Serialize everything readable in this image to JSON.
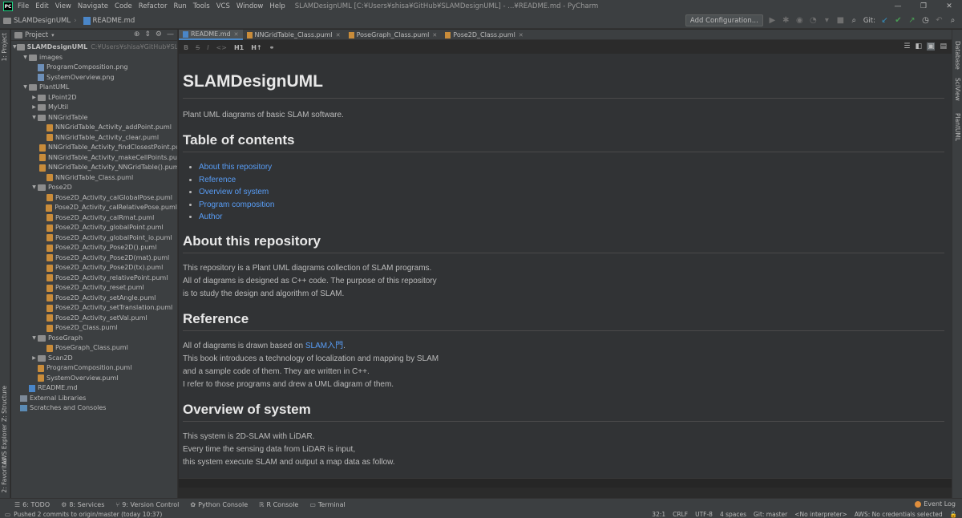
{
  "window": {
    "title": "SLAMDesignUML [C:¥Users¥shisa¥GitHub¥SLAMDesignUML] - ...¥README.md - PyCharm"
  },
  "menu": [
    "File",
    "Edit",
    "View",
    "Navigate",
    "Code",
    "Refactor",
    "Run",
    "Tools",
    "VCS",
    "Window",
    "Help"
  ],
  "navbar": {
    "project": "SLAMDesignUML",
    "file": "README.md",
    "add_configuration": "Add Configuration...",
    "git_label": "Git:"
  },
  "left_stripe": {
    "project": "1: Project",
    "structure": "Z: Structure",
    "aws": "AWS Explorer",
    "favorites": "2: Favorites"
  },
  "right_stripe": {
    "database": "Database",
    "sciview": "SciView",
    "plantuml": "PlantUML"
  },
  "project_panel": {
    "title": "Project",
    "root": "SLAMDesignUML",
    "root_path": "C:¥Users¥shisa¥GitHub¥SLAMDesignUML",
    "tree": [
      {
        "label": "images",
        "type": "folder",
        "depth": 1,
        "open": true
      },
      {
        "label": "ProgramComposition.png",
        "type": "png",
        "depth": 2
      },
      {
        "label": "SystemOverview.png",
        "type": "png",
        "depth": 2
      },
      {
        "label": "PlantUML",
        "type": "folder",
        "depth": 1,
        "open": true
      },
      {
        "label": "LPoint2D",
        "type": "folder",
        "depth": 2,
        "open": false
      },
      {
        "label": "MyUtil",
        "type": "folder",
        "depth": 2,
        "open": false
      },
      {
        "label": "NNGridTable",
        "type": "folder",
        "depth": 2,
        "open": true
      },
      {
        "label": "NNGridTable_Activity_addPoint.puml",
        "type": "puml",
        "depth": 3
      },
      {
        "label": "NNGridTable_Activity_clear.puml",
        "type": "puml",
        "depth": 3
      },
      {
        "label": "NNGridTable_Activity_findClosestPoint.puml",
        "type": "puml",
        "depth": 3
      },
      {
        "label": "NNGridTable_Activity_makeCellPoints.puml",
        "type": "puml",
        "depth": 3
      },
      {
        "label": "NNGridTable_Activity_NNGridTable().puml",
        "type": "puml",
        "depth": 3
      },
      {
        "label": "NNGridTable_Class.puml",
        "type": "puml",
        "depth": 3
      },
      {
        "label": "Pose2D",
        "type": "folder",
        "depth": 2,
        "open": true
      },
      {
        "label": "Pose2D_Activity_calGlobalPose.puml",
        "type": "puml",
        "depth": 3
      },
      {
        "label": "Pose2D_Activity_calRelativePose.puml",
        "type": "puml",
        "depth": 3
      },
      {
        "label": "Pose2D_Activity_calRmat.puml",
        "type": "puml",
        "depth": 3
      },
      {
        "label": "Pose2D_Activity_globalPoint.puml",
        "type": "puml",
        "depth": 3
      },
      {
        "label": "Pose2D_Activity_globalPoint_io.puml",
        "type": "puml",
        "depth": 3
      },
      {
        "label": "Pose2D_Activity_Pose2D().puml",
        "type": "puml",
        "depth": 3
      },
      {
        "label": "Pose2D_Activity_Pose2D(mat).puml",
        "type": "puml",
        "depth": 3
      },
      {
        "label": "Pose2D_Activity_Pose2D(tx).puml",
        "type": "puml",
        "depth": 3
      },
      {
        "label": "Pose2D_Activity_relativePoint.puml",
        "type": "puml",
        "depth": 3
      },
      {
        "label": "Pose2D_Activity_reset.puml",
        "type": "puml",
        "depth": 3
      },
      {
        "label": "Pose2D_Activity_setAngle.puml",
        "type": "puml",
        "depth": 3
      },
      {
        "label": "Pose2D_Activity_setTranslation.puml",
        "type": "puml",
        "depth": 3
      },
      {
        "label": "Pose2D_Activity_setVal.puml",
        "type": "puml",
        "depth": 3
      },
      {
        "label": "Pose2D_Class.puml",
        "type": "puml",
        "depth": 3
      },
      {
        "label": "PoseGraph",
        "type": "folder",
        "depth": 2,
        "open": true
      },
      {
        "label": "PoseGraph_Class.puml",
        "type": "puml",
        "depth": 3
      },
      {
        "label": "Scan2D",
        "type": "folder",
        "depth": 2,
        "open": false
      },
      {
        "label": "ProgramComposition.puml",
        "type": "puml",
        "depth": 2
      },
      {
        "label": "SystemOverview.puml",
        "type": "puml",
        "depth": 2
      },
      {
        "label": "README.md",
        "type": "md",
        "depth": 1
      },
      {
        "label": "External Libraries",
        "type": "lib",
        "depth": 0
      },
      {
        "label": "Scratches and Consoles",
        "type": "scratch",
        "depth": 0
      }
    ]
  },
  "tabs": [
    {
      "label": "README.md",
      "active": true
    },
    {
      "label": "NNGridTable_Class.puml",
      "active": false
    },
    {
      "label": "PoseGraph_Class.puml",
      "active": false
    },
    {
      "label": "Pose2D_Class.puml",
      "active": false
    }
  ],
  "md_toolbar": {
    "h1": "H1",
    "h2": "H↑"
  },
  "preview": {
    "title": "SLAMDesignUML",
    "intro": "Plant UML diagrams of basic SLAM software.",
    "toc_heading": "Table of contents",
    "toc": [
      "About this repository",
      "Reference",
      "Overview of system",
      "Program composition",
      "Author"
    ],
    "about_heading": "About this repository",
    "about_lines": [
      "This repository is a Plant UML diagrams collection of SLAM programs.",
      "All of diagrams is designed as C++ code. The purpose of this repository",
      "is to study the design and algorithm of SLAM."
    ],
    "reference_heading": "Reference",
    "reference_prefix": "All of diagrams is drawn based on ",
    "reference_link": "SLAM入門",
    "reference_suffix": ".",
    "reference_lines": [
      "This book introduces a technology of localization and mapping by SLAM",
      "and a sample code of them. They are written in C++.",
      "I refer to those programs and drew a UML diagram of them."
    ],
    "overview_heading": "Overview of system",
    "overview_lines": [
      "This system is 2D-SLAM with LiDAR.",
      "Every time the sensing data from LiDAR is input,",
      "this system execute SLAM and output a map data as follow."
    ]
  },
  "tool_windows": [
    {
      "label": "6: TODO",
      "icon": "list-icon"
    },
    {
      "label": "8: Services",
      "icon": "services-icon"
    },
    {
      "label": "9: Version Control",
      "icon": "vcs-icon"
    },
    {
      "label": "Python Console",
      "icon": "python-icon"
    },
    {
      "label": "R Console",
      "icon": "r-icon"
    },
    {
      "label": "Terminal",
      "icon": "terminal-icon"
    }
  ],
  "event_log": "Event Log",
  "status": {
    "message": "Pushed 2 commits to origin/master (today 10:37)",
    "position": "32:1",
    "line_sep": "CRLF",
    "encoding": "UTF-8",
    "indent": "4 spaces",
    "git": "Git: master",
    "interpreter": "<No interpreter>",
    "aws": "AWS: No credentials selected"
  }
}
